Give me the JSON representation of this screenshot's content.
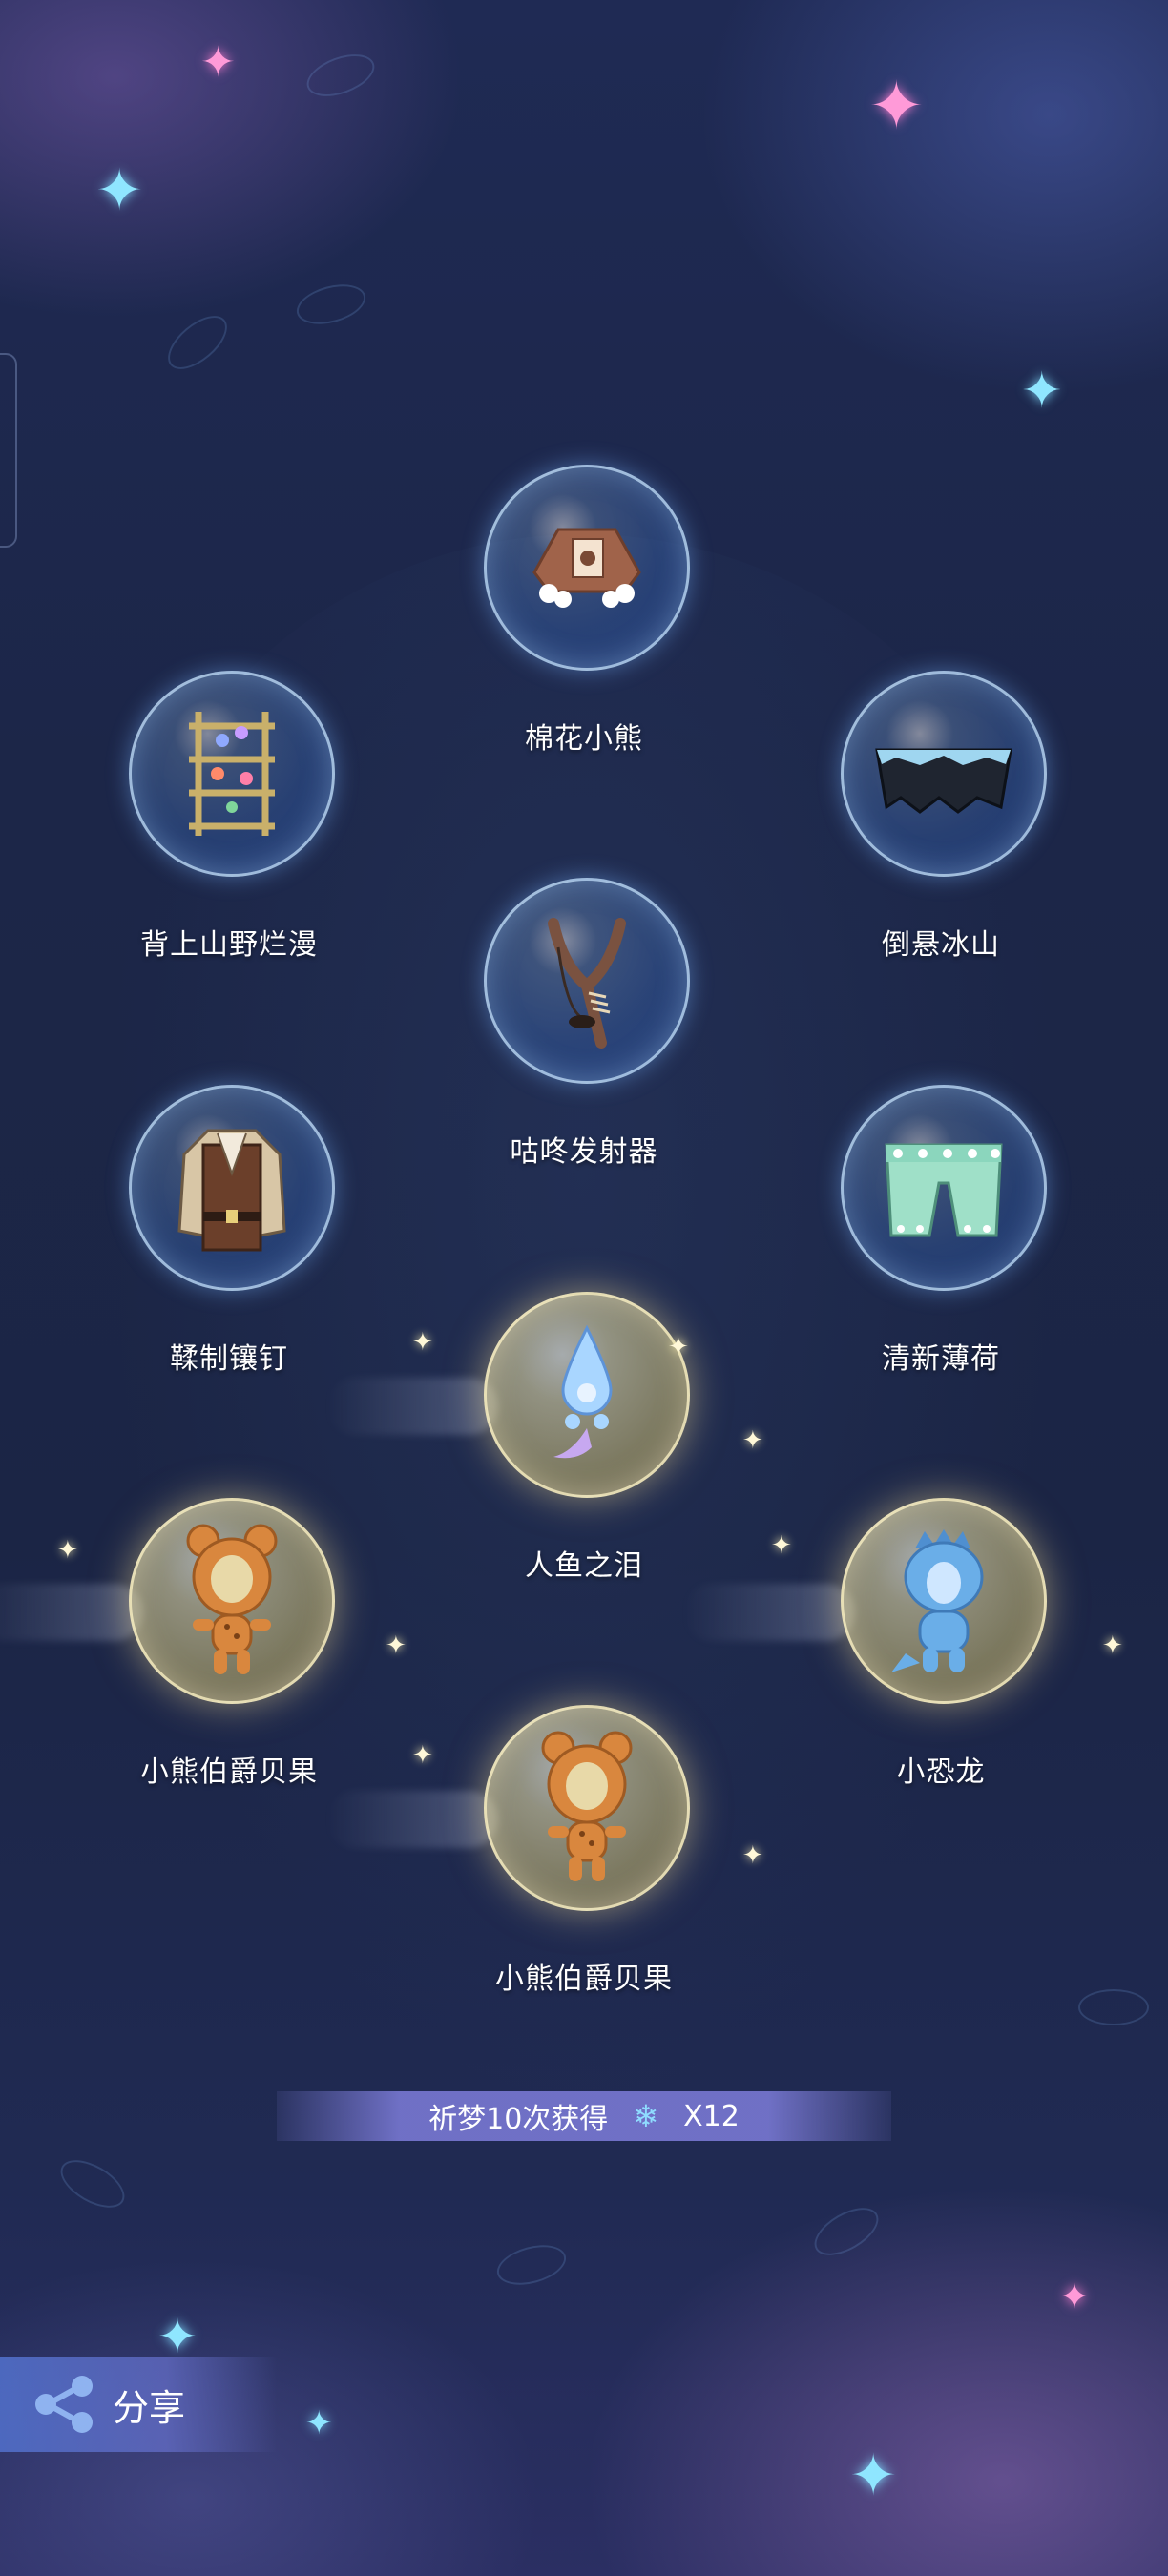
{
  "colors": {
    "background": "#1c2648",
    "accent_bar": "#7878d2",
    "label_text": "#ffffff",
    "snowflake": "#8fdcff"
  },
  "items": [
    {
      "label": "棉花小熊",
      "rarity": "blue",
      "icon": "bear-cape-icon"
    },
    {
      "label": "背上山野烂漫",
      "rarity": "blue",
      "icon": "flower-trellis-icon"
    },
    {
      "label": "倒悬冰山",
      "rarity": "blue",
      "icon": "ice-cape-icon"
    },
    {
      "label": "咕咚发射器",
      "rarity": "blue",
      "icon": "slingshot-icon"
    },
    {
      "label": "鞣制镶钉",
      "rarity": "blue",
      "icon": "leather-jacket-icon"
    },
    {
      "label": "清新薄荷",
      "rarity": "blue",
      "icon": "mint-shorts-icon"
    },
    {
      "label": "人鱼之泪",
      "rarity": "gold",
      "icon": "mermaid-tear-icon"
    },
    {
      "label": "小熊伯爵贝果",
      "rarity": "gold",
      "icon": "bagel-bear-icon"
    },
    {
      "label": "小恐龙",
      "rarity": "gold",
      "icon": "dinosaur-icon"
    },
    {
      "label": "小熊伯爵贝果",
      "rarity": "gold",
      "icon": "bagel-bear-icon"
    }
  ],
  "reward": {
    "text": "祈梦10次获得",
    "icon": "snowflake-icon",
    "count": "X12"
  },
  "share": {
    "label": "分享",
    "icon": "share-icon"
  }
}
